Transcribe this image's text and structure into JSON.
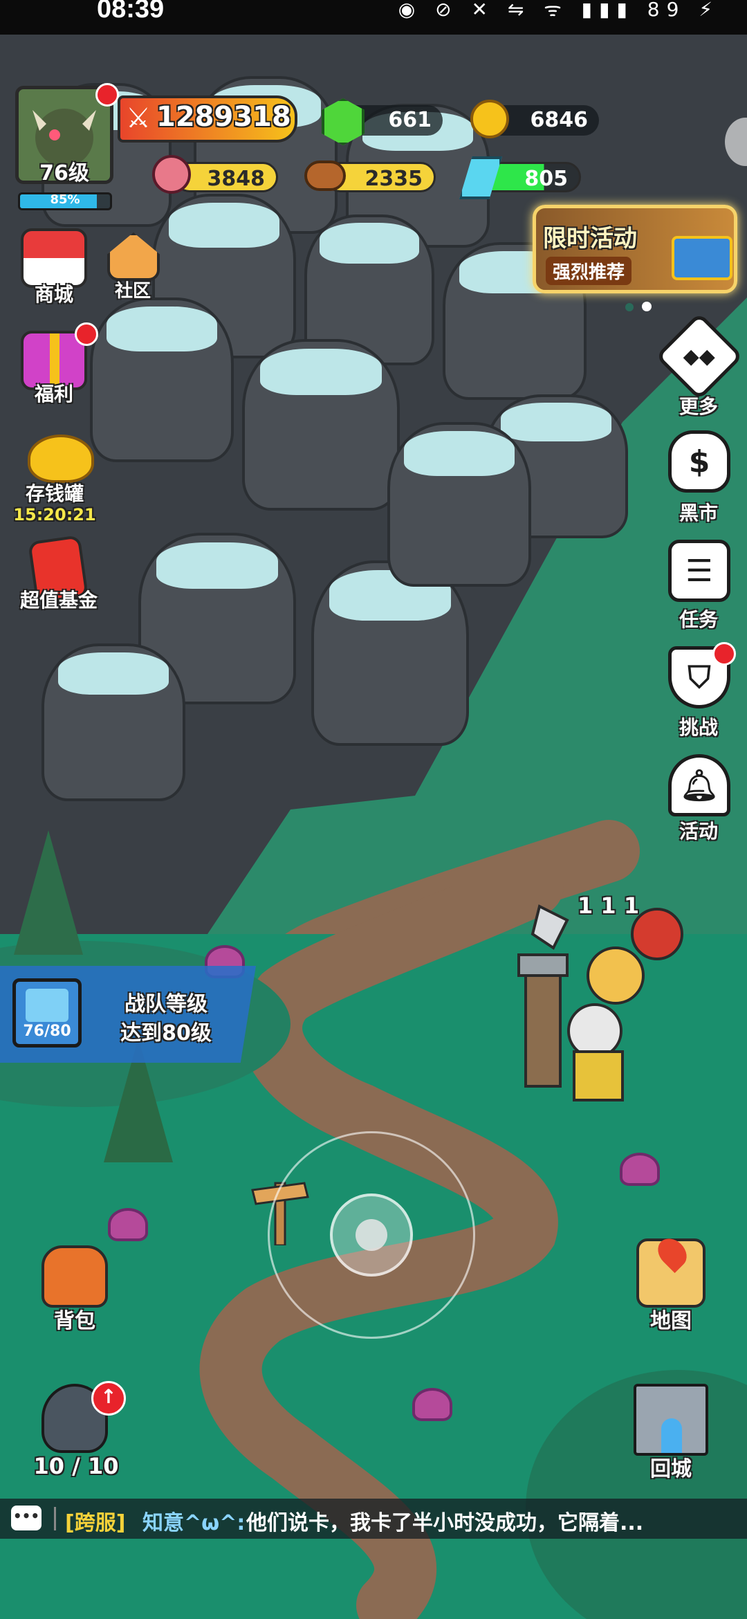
{
  "status_bar": {
    "time": "08:39",
    "battery": "89"
  },
  "player": {
    "level": "76级",
    "exp_percent": "85%",
    "exp_fraction": 0.85,
    "power": "1289318"
  },
  "resources": {
    "gems": "661",
    "gold": "6846",
    "meat": "3848",
    "wood": "2335",
    "crystal": "805"
  },
  "left_menu": {
    "shop": "商城",
    "community": "社区",
    "welfare": "福利",
    "piggy_bank": "存钱罐",
    "piggy_timer": "15:20:21",
    "fund": "超值基金"
  },
  "event_banner": {
    "title": "限时活动",
    "subtitle": "强烈推荐"
  },
  "right_menu": {
    "more": "更多",
    "black_market": "黑市",
    "tasks": "任务",
    "challenge": "挑战",
    "activity": "活动"
  },
  "quest": {
    "progress": "76/80",
    "line1": "战队等级",
    "line2": "达到80级"
  },
  "damage_numbers": "1 1 1",
  "bottom": {
    "bag": "背包",
    "map": "地图",
    "heroes_count": "10 / 10",
    "return_city": "回城"
  },
  "chat": {
    "channel": "[跨服]",
    "user": "知意^ω^:",
    "message": "他们说卡，我卡了半小时没成功，它隔着..."
  },
  "colors": {
    "gem_green": "#4fd63a",
    "gold": "#f6c21b",
    "meat_bar": "#f5d33a",
    "crystal_bar": "#2ee64a",
    "power_bar": "#e8452b"
  }
}
